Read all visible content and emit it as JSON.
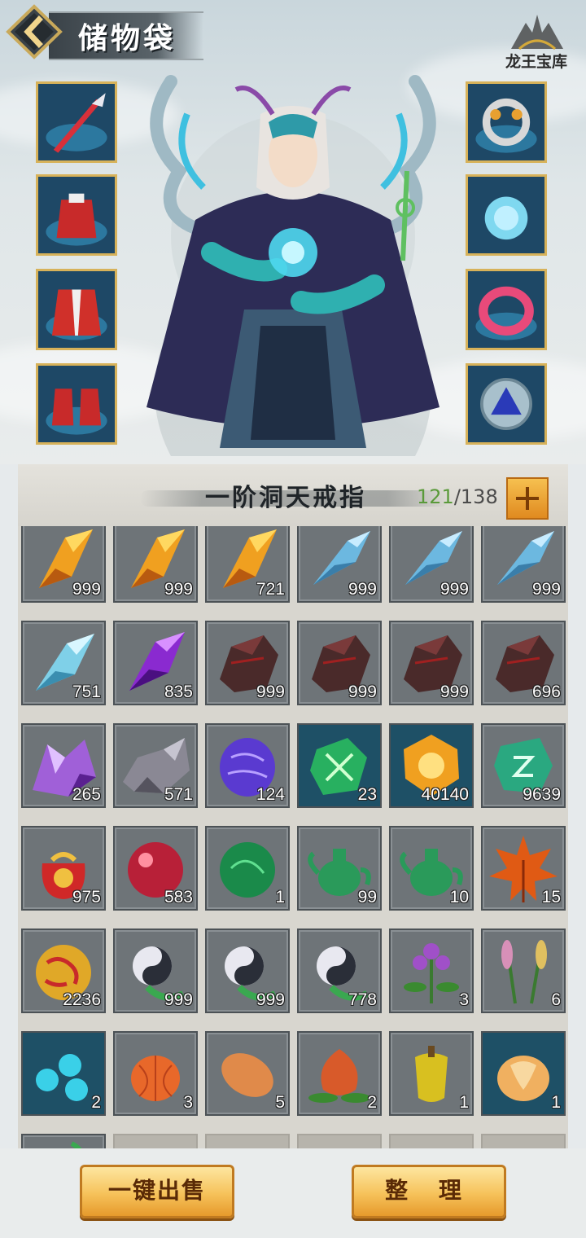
{
  "header": {
    "title": "储物袋",
    "logo_text": "龙王宝库"
  },
  "equipment": {
    "left": [
      "sword",
      "armor",
      "robe",
      "boots"
    ],
    "right": [
      "ring-gold",
      "orb-ring",
      "pink-bangle",
      "blue-amulet"
    ]
  },
  "bag": {
    "title": "一阶洞天戒指",
    "capacity_used": "121",
    "capacity_sep": "/",
    "capacity_total": "138",
    "rows": [
      [
        {
          "icon": "orange-crystal",
          "count": "999"
        },
        {
          "icon": "orange-crystal",
          "count": "999"
        },
        {
          "icon": "orange-crystal",
          "count": "721"
        },
        {
          "icon": "blue-feather",
          "count": "999"
        },
        {
          "icon": "blue-feather",
          "count": "999"
        },
        {
          "icon": "blue-feather",
          "count": "999"
        }
      ],
      [
        {
          "icon": "blue-crystal",
          "count": "751"
        },
        {
          "icon": "purple-crystal",
          "count": "835"
        },
        {
          "icon": "dark-ore",
          "count": "999"
        },
        {
          "icon": "dark-ore",
          "count": "999"
        },
        {
          "icon": "dark-ore",
          "count": "999"
        },
        {
          "icon": "dark-ore",
          "count": "696"
        }
      ],
      [
        {
          "icon": "amethyst-cluster",
          "count": "265"
        },
        {
          "icon": "grey-rock",
          "count": "571"
        },
        {
          "icon": "purple-gem",
          "count": "124"
        },
        {
          "icon": "green-gem",
          "count": "23"
        },
        {
          "icon": "orange-gem",
          "count": "40140"
        },
        {
          "icon": "jade-rune",
          "count": "9639"
        }
      ],
      [
        {
          "icon": "red-pouch",
          "count": "975"
        },
        {
          "icon": "red-pearl",
          "count": "583"
        },
        {
          "icon": "green-pearl",
          "count": "1"
        },
        {
          "icon": "jade-teapot",
          "count": "99"
        },
        {
          "icon": "jade-teapot",
          "count": "10"
        },
        {
          "icon": "maple-leaf",
          "count": "15"
        }
      ],
      [
        {
          "icon": "gold-orb",
          "count": "2236"
        },
        {
          "icon": "yinyang-charm",
          "count": "999"
        },
        {
          "icon": "yinyang-charm",
          "count": "999"
        },
        {
          "icon": "yinyang-charm",
          "count": "778"
        },
        {
          "icon": "purple-herb",
          "count": "3"
        },
        {
          "icon": "pink-herb",
          "count": "6"
        }
      ],
      [
        {
          "icon": "blue-berries",
          "count": "2"
        },
        {
          "icon": "orange-lantern-fruit",
          "count": "3"
        },
        {
          "icon": "sweet-potato",
          "count": "5"
        },
        {
          "icon": "red-bulb",
          "count": "2"
        },
        {
          "icon": "star-fruit",
          "count": "1"
        },
        {
          "icon": "fox-jade",
          "count": "1"
        }
      ],
      [
        {
          "icon": "green-item",
          "count": ""
        },
        {
          "icon": "empty",
          "count": ""
        },
        {
          "icon": "empty",
          "count": ""
        },
        {
          "icon": "empty",
          "count": ""
        },
        {
          "icon": "empty",
          "count": ""
        },
        {
          "icon": "empty",
          "count": ""
        }
      ]
    ]
  },
  "buttons": {
    "sell_all": "一键出售",
    "sort": "整 理"
  }
}
